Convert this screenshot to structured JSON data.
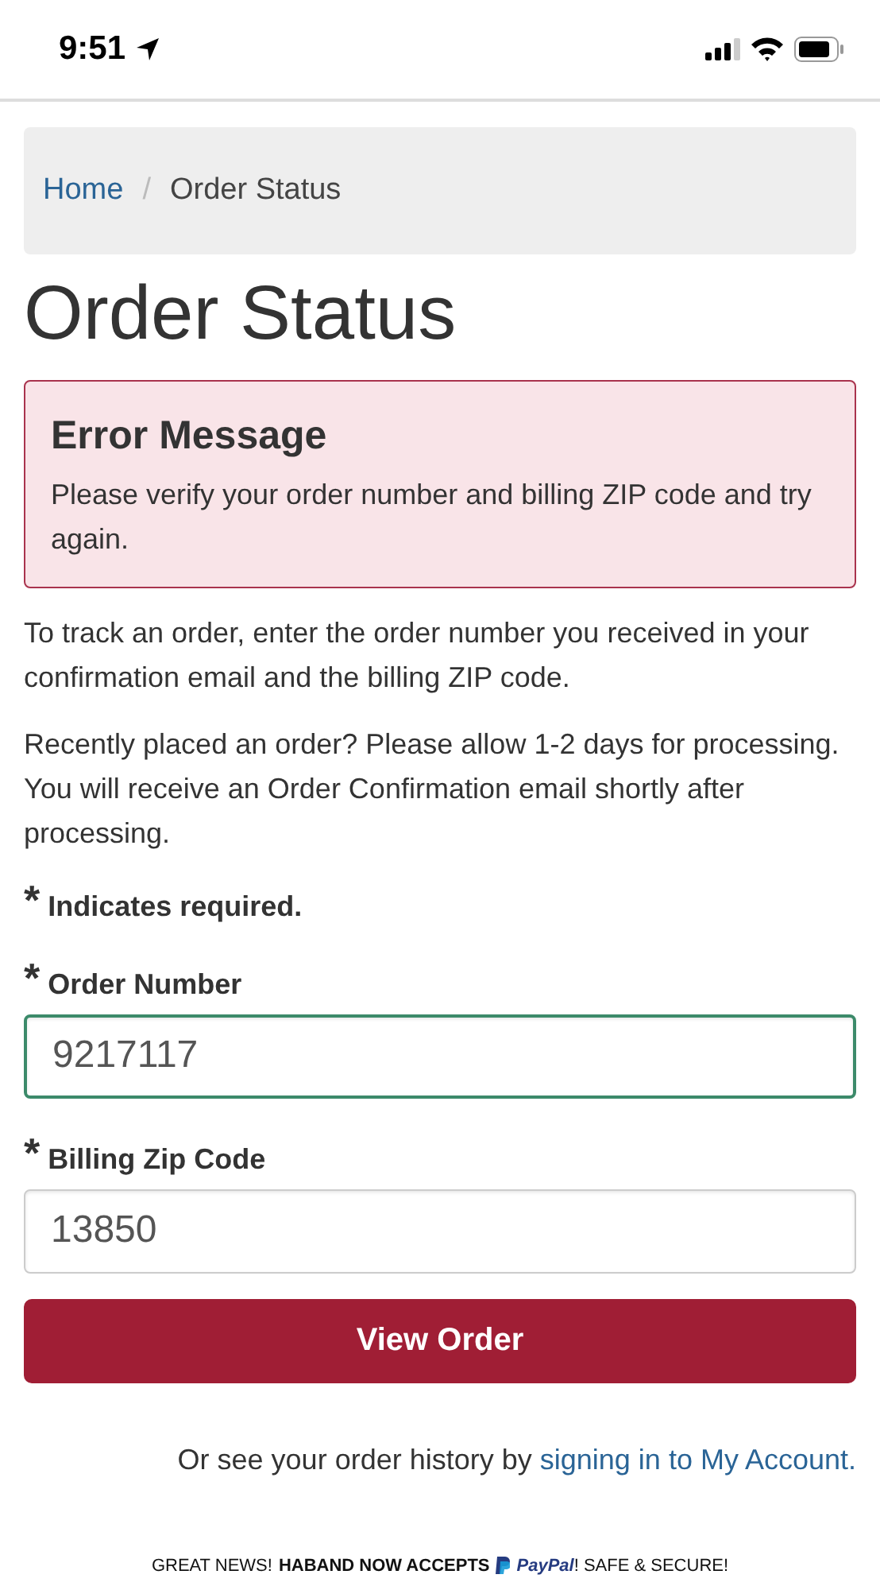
{
  "status_bar": {
    "time": "9:51"
  },
  "breadcrumb": [
    {
      "label": "Home",
      "kind": "link"
    },
    {
      "label": "/",
      "kind": "separator"
    },
    {
      "label": "Order Status",
      "kind": "current"
    }
  ],
  "title": "Order Status",
  "error": {
    "heading": "Error Message",
    "text": "Please verify your order number and billing ZIP code and try again."
  },
  "intro": [
    "To track an order, enter the order number you received in your confirmation email and the billing ZIP code.",
    "Recently placed an order? Please allow 1-2 days for processing. You will receive an Order Confirmation email shortly after processing."
  ],
  "required_note": {
    "mark": "*",
    "text": "Indicates required."
  },
  "fields": [
    {
      "mark": "*",
      "label": "Order Number",
      "value": "9217117",
      "focused": true
    },
    {
      "mark": "*",
      "label": "Billing Zip Code",
      "value": "13850",
      "focused": false
    }
  ],
  "submit_button": "View Order",
  "history": {
    "text": "Or see your order history by",
    "link": "signing in to My Account."
  },
  "banner": {
    "lead": "GREAT NEWS!",
    "bold": "HABAND NOW ACCEPTS",
    "brand": "PayPal",
    "tail": "! SAFE & SECURE!"
  }
}
